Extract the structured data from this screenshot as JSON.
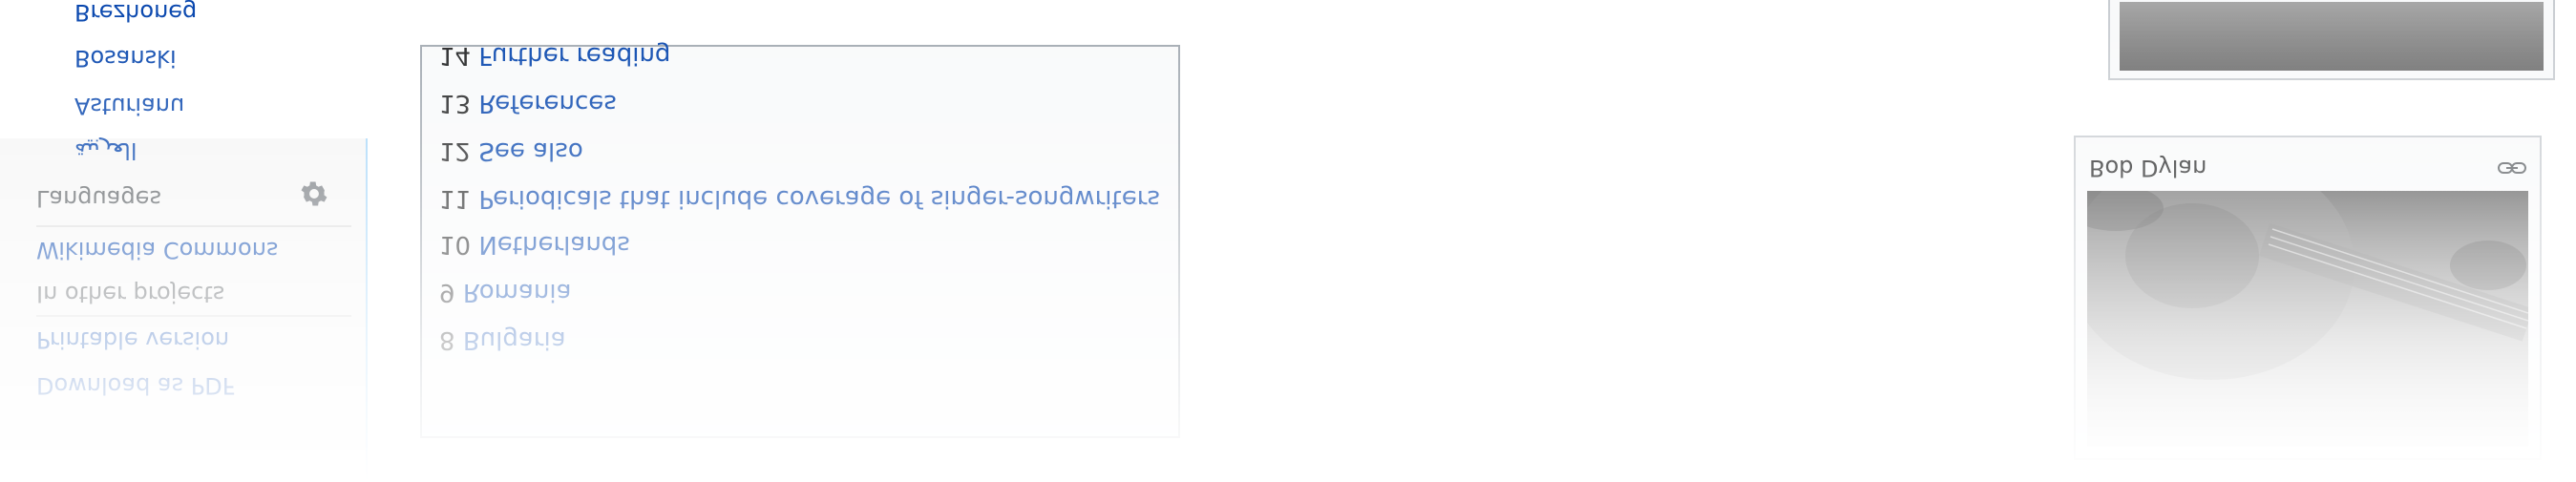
{
  "sidebar": {
    "tools_items": [
      "Download as PDF",
      "Printable version"
    ],
    "other_projects_heading": "In other projects",
    "other_projects_items": [
      "Wikimedia Commons"
    ],
    "languages_heading": "Languages",
    "language_items": [
      "العربية",
      "Asturianu",
      "Bosanski",
      "Brezhoneg"
    ]
  },
  "toc": {
    "items": [
      {
        "num": "8",
        "text": "Bulgaria"
      },
      {
        "num": "9",
        "text": "Romania"
      },
      {
        "num": "10",
        "text": "Netherlands"
      },
      {
        "num": "11",
        "text": "Periodicals that include coverage of singer-songwriters"
      },
      {
        "num": "12",
        "text": "See also"
      },
      {
        "num": "13",
        "text": "References"
      },
      {
        "num": "14",
        "text": "Further reading"
      }
    ]
  },
  "infobox": {
    "title": "Bob Dylan",
    "icons": {
      "settings": "gear-icon",
      "link": "link-icon"
    }
  },
  "colors": {
    "link": "#0645ad",
    "text": "#202122",
    "sidebar_bg": "#f6f6f6",
    "toc_bg": "#f8f9fa",
    "border": "#a2a9b1"
  }
}
